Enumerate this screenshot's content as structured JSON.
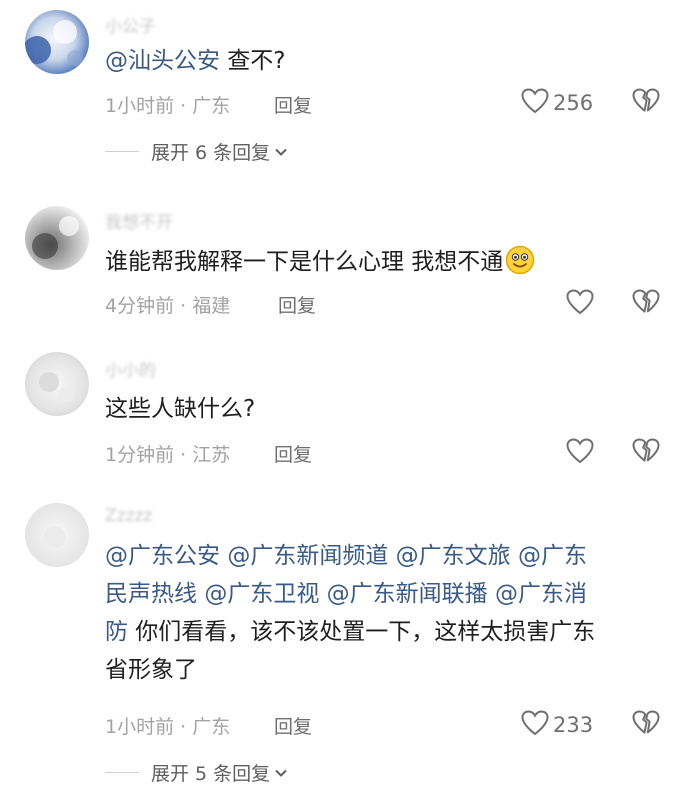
{
  "comments": [
    {
      "username": "小公子",
      "parts": [
        {
          "text": "@汕头公安",
          "mention": true
        },
        {
          "text": " 查不?",
          "mention": false
        }
      ],
      "meta": "1小时前 · 广东",
      "reply_label": "回复",
      "like_count": "256",
      "expand_label": "展开 6 条回复"
    },
    {
      "username": "我想不开",
      "text": "谁能帮我解释一下是什么心理 我想不通",
      "emoji": "smiling-face-emoji",
      "meta": "4分钟前 · 福建",
      "reply_label": "回复",
      "like_count": ""
    },
    {
      "username": "小小的",
      "text": "这些人缺什么?",
      "meta": "1分钟前 · 江苏",
      "reply_label": "回复",
      "like_count": ""
    },
    {
      "username": "Zzzzz",
      "lines": [
        [
          {
            "text": "@广东公安",
            "mention": true
          },
          {
            "text": " ",
            "mention": false
          },
          {
            "text": "@广东新闻频道",
            "mention": true
          },
          {
            "text": " ",
            "mention": false
          },
          {
            "text": "@广东文旅",
            "mention": true
          },
          {
            "text": " ",
            "mention": false
          },
          {
            "text": "@广东",
            "mention": true
          }
        ],
        [
          {
            "text": "民声热线",
            "mention": true
          },
          {
            "text": " ",
            "mention": false
          },
          {
            "text": "@广东卫视",
            "mention": true
          },
          {
            "text": " ",
            "mention": false
          },
          {
            "text": "@广东新闻联播",
            "mention": true
          },
          {
            "text": " ",
            "mention": false
          },
          {
            "text": "@广东消",
            "mention": true
          }
        ],
        [
          {
            "text": "防",
            "mention": true
          },
          {
            "text": " 你们看看，该不该处置一下，这样太损害广东",
            "mention": false
          }
        ],
        [
          {
            "text": "省形象了",
            "mention": false
          }
        ]
      ],
      "meta": "1小时前 · 广东",
      "reply_label": "回复",
      "like_count": "233",
      "expand_label": "展开 5 条回复"
    }
  ],
  "icons": {
    "like": "heart-outline-icon",
    "dislike": "broken-heart-icon",
    "expand": "chevron-down-icon"
  },
  "colors": {
    "mention": "#3a5a86",
    "meta": "#a3a3a3",
    "action": "#6f6f6f",
    "text": "#1f1f1f"
  }
}
